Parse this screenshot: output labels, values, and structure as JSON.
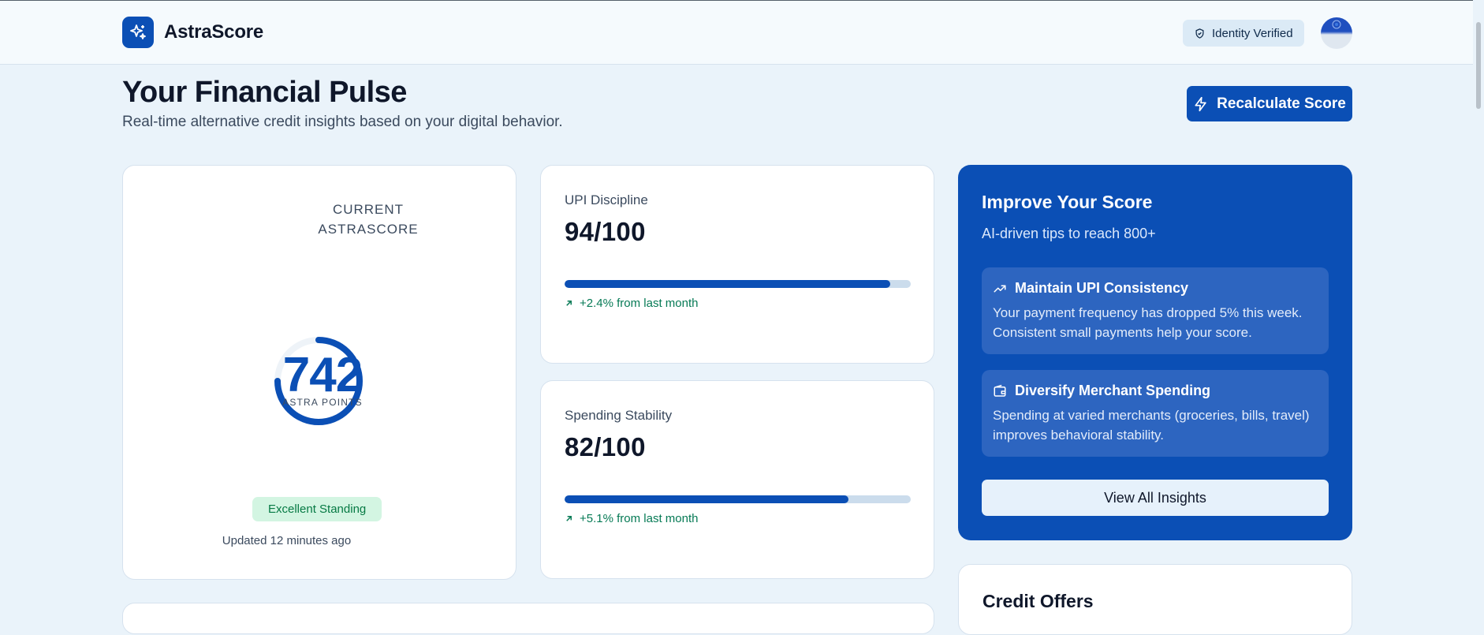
{
  "header": {
    "brand_name": "AstraScore",
    "verified_label": "Identity Verified"
  },
  "page": {
    "title": "Your Financial Pulse",
    "subtitle": "Real-time alternative credit insights based on your digital behavior.",
    "recalc_label": "Recalculate Score"
  },
  "score": {
    "label_line1": "CURRENT",
    "label_line2": "ASTRASCORE",
    "value": "742",
    "unit": "ASTRA POINTS",
    "standing": "Excellent Standing",
    "updated": "Updated 12 minutes ago"
  },
  "metrics": [
    {
      "name": "UPI Discipline",
      "value": "94/100",
      "progress": 0.94,
      "trend": "+2.4% from last month"
    },
    {
      "name": "Spending Stability",
      "value": "82/100",
      "progress": 0.82,
      "trend": "+5.1% from last month"
    }
  ],
  "improve": {
    "title": "Improve Your Score",
    "subtitle": "AI-driven tips to reach 800+",
    "tips": [
      {
        "icon": "trending-up-icon",
        "title": "Maintain UPI Consistency",
        "body": "Your payment frequency has dropped 5% this week. Consistent small payments help your score."
      },
      {
        "icon": "wallet-icon",
        "title": "Diversify Merchant Spending",
        "body": "Spending at varied merchants (groceries, bills, travel) improves behavioral stability."
      }
    ],
    "button_label": "View All Insights"
  },
  "offers": {
    "title": "Credit Offers"
  },
  "colors": {
    "primary": "#0b4fb5",
    "success": "#067a55",
    "success_bg": "#d3f5e2"
  }
}
